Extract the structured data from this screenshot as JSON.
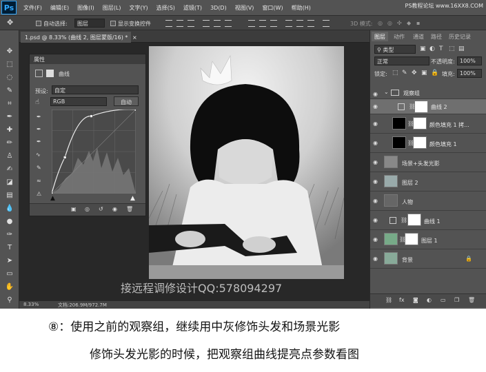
{
  "menubar": {
    "logo": "Ps",
    "items": [
      "文件(F)",
      "编辑(E)",
      "图像(I)",
      "图层(L)",
      "文字(Y)",
      "选择(S)",
      "滤镜(T)",
      "3D(D)",
      "视图(V)",
      "窗口(W)",
      "帮助(H)"
    ],
    "watermark": "PS教程论坛 www.16XX8.COM"
  },
  "options": {
    "auto_select": "自动选择:",
    "auto_select_value": "图层",
    "show_transform": "显示变换控件",
    "mode_3d": "3D 模式:"
  },
  "doc": {
    "tab_title": "1.psd @ 8.33% (曲线 2, 图层蒙版/16) *",
    "close": "×",
    "zoom": "8.33%",
    "doc_size": "文档:206.9M/972.7M"
  },
  "properties": {
    "title": "属性",
    "panel_name": "曲线",
    "preset_label": "预设:",
    "preset_value": "自定",
    "channel": "RGB",
    "auto_btn": "自动"
  },
  "layers_panel": {
    "tabs": [
      "图层",
      "动作",
      "通道",
      "路径",
      "历史记录"
    ],
    "kind_label": "类型",
    "blend": "正常",
    "opacity_label": "不透明度:",
    "opacity": "100%",
    "lock_label": "锁定:",
    "fill_label": "填充:",
    "fill": "100%",
    "rows": [
      {
        "name": "观察组"
      },
      {
        "name": "曲线 2"
      },
      {
        "name": "颜色填充 1 拷..."
      },
      {
        "name": "颜色填充 1"
      },
      {
        "name": "场景+头发光影"
      },
      {
        "name": "图层 2"
      },
      {
        "name": "人物"
      },
      {
        "name": "曲线 1"
      },
      {
        "name": "图层 1"
      },
      {
        "name": "背景"
      }
    ]
  },
  "overlay_text": "接远程调修设计QQ:578094297",
  "caption": {
    "line1": "⑧：使用之前的观察组，继续用中灰修饰头发和场景光影",
    "line2": "修饰头发光影的时候，把观察组曲线提亮点参数看图"
  },
  "chart_data": {
    "type": "line",
    "title": "",
    "xlabel": "",
    "ylabel": "",
    "xlim": [
      0,
      255
    ],
    "ylim": [
      0,
      255
    ],
    "series": [
      {
        "values_x": [
          0,
          40,
          120,
          255
        ],
        "values_y": [
          0,
          110,
          235,
          255
        ]
      }
    ]
  }
}
